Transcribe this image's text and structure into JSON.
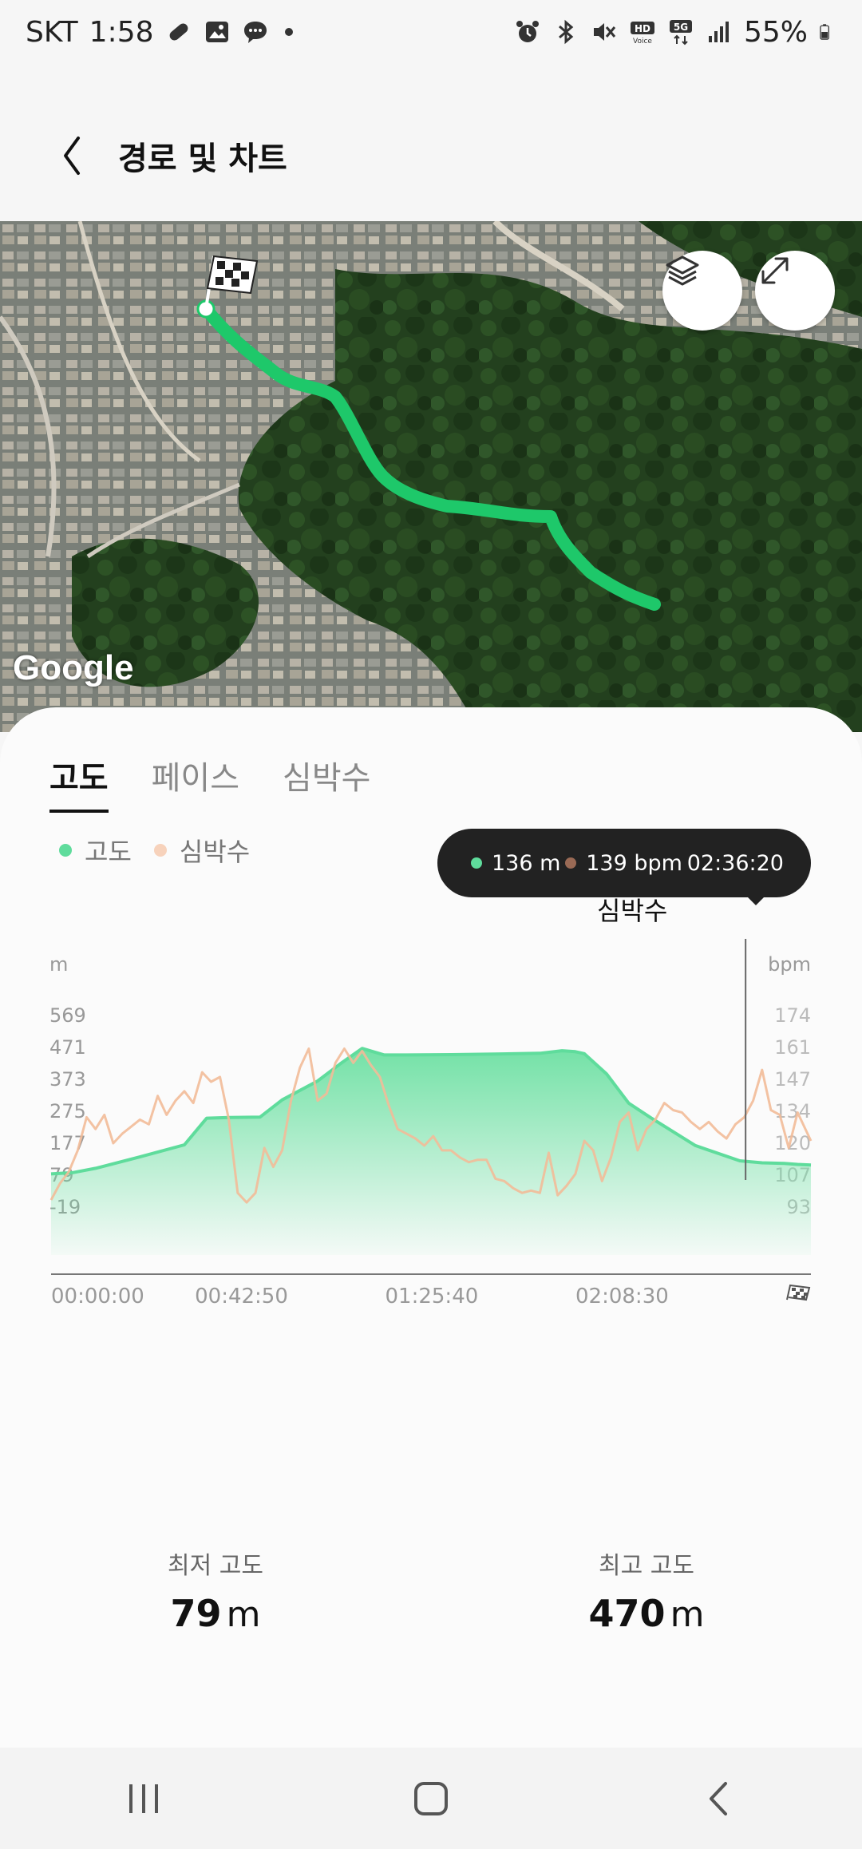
{
  "status": {
    "carrier": "SKT",
    "time": "1:58",
    "battery": "55%"
  },
  "header": {
    "title": "경로 및 차트"
  },
  "map": {
    "attribution": "Google",
    "icons": [
      "finish-flag-icon",
      "layers-icon",
      "expand-icon"
    ]
  },
  "tabs": [
    "고도",
    "페이스",
    "심박수"
  ],
  "legend": {
    "elevation": "고도",
    "heart_rate": "심박수"
  },
  "tooltip": {
    "elevation": "136 m",
    "heart_rate": "139 bpm",
    "time": "02:36:20",
    "label": "심박수"
  },
  "colors": {
    "elevation": "#5fdc9c",
    "heart_rate": "#f2bb98",
    "route": "#1ec86a",
    "tooltip_bg": "#222222"
  },
  "chart_data": {
    "type": "area",
    "left_unit": "m",
    "right_unit": "bpm",
    "y_left_ticks": [
      "569",
      "471",
      "373",
      "275",
      "177",
      "79",
      "-19"
    ],
    "y_right_ticks": [
      "174",
      "161",
      "147",
      "134",
      "120",
      "107",
      "93"
    ],
    "y_left_range": [
      -19,
      569
    ],
    "y_right_range": [
      93,
      174
    ],
    "x_ticks": [
      "00:00:00",
      "00:42:50",
      "01:25:40",
      "02:08:30"
    ],
    "x_range_min": [
      0,
      171
    ],
    "cursor_min": 156.3,
    "series": [
      {
        "name": "고도",
        "axis": "left",
        "x": [
          0,
          5,
          10,
          20,
          30,
          35,
          40,
          47,
          52,
          60,
          65,
          70,
          75,
          80,
          90,
          100,
          110,
          115,
          118,
          120,
          125,
          130,
          135,
          145,
          155,
          160,
          165,
          168,
          171
        ],
        "y": [
          83,
          87,
          100,
          135,
          172,
          254,
          256,
          257,
          310,
          368,
          420,
          468,
          448,
          448,
          449,
          451,
          453,
          461,
          458,
          452,
          390,
          300,
          255,
          170,
          123,
          117,
          115,
          112,
          110
        ]
      },
      {
        "name": "심박수",
        "axis": "right",
        "x": [
          0,
          2,
          4,
          6,
          8,
          10,
          12,
          14,
          16,
          18,
          20,
          22,
          24,
          26,
          28,
          30,
          32,
          34,
          36,
          38,
          40,
          42,
          44,
          46,
          48,
          50,
          52,
          54,
          56,
          58,
          60,
          62,
          64,
          66,
          68,
          70,
          72,
          74,
          76,
          78,
          80,
          82,
          84,
          86,
          88,
          90,
          92,
          94,
          96,
          98,
          100,
          102,
          104,
          106,
          108,
          110,
          112,
          114,
          116,
          118,
          120,
          122,
          124,
          126,
          128,
          130,
          132,
          134,
          136,
          138,
          140,
          142,
          144,
          146,
          148,
          150,
          152,
          154,
          156,
          158,
          160,
          162,
          164,
          166,
          168,
          171
        ],
        "y": [
          96,
          103,
          108,
          117,
          131,
          126,
          132,
          120,
          124,
          127,
          130,
          128,
          140,
          132,
          138,
          142,
          137,
          150,
          146,
          148,
          130,
          99,
          95,
          99,
          118,
          110,
          117,
          138,
          152,
          160,
          138,
          141,
          154,
          160,
          154,
          159,
          153,
          148,
          136,
          126,
          124,
          122,
          119,
          123,
          117,
          117,
          114,
          112,
          113,
          113,
          105,
          104,
          101,
          99,
          100,
          99,
          116,
          98,
          102,
          107,
          121,
          117,
          104,
          114,
          129,
          133,
          117,
          126,
          130,
          137,
          134,
          133,
          129,
          126,
          129,
          125,
          122,
          128,
          131,
          138,
          151,
          134,
          132,
          118,
          133,
          121
        ]
      }
    ]
  },
  "stats": {
    "min_label": "최저 고도",
    "min_value": "79",
    "max_label": "최고 고도",
    "max_value": "470",
    "unit": "m"
  }
}
